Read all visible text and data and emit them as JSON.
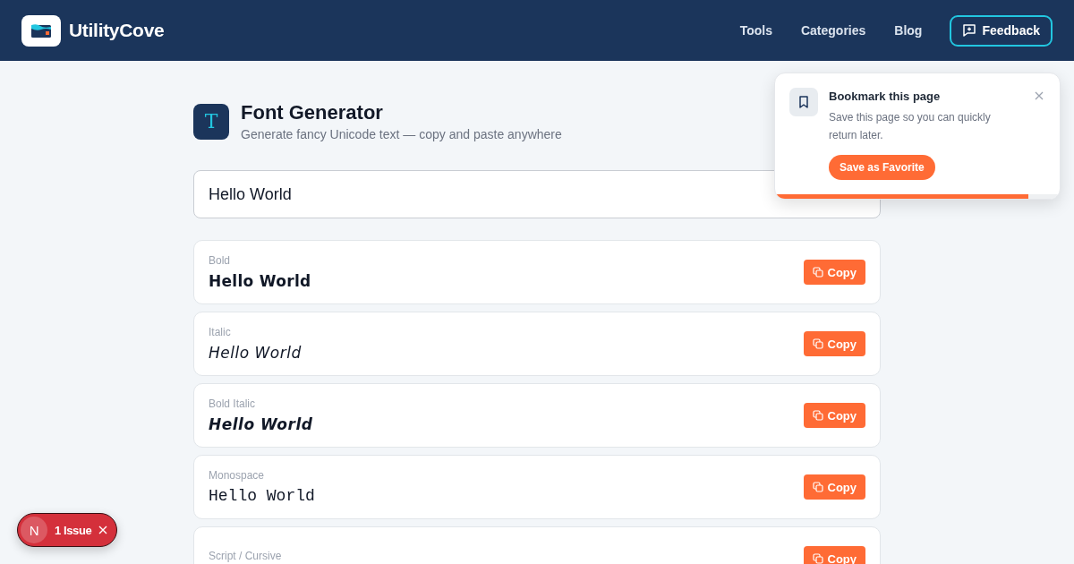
{
  "header": {
    "brand": "UtilityCove",
    "nav": [
      {
        "label": "Tools"
      },
      {
        "label": "Categories"
      },
      {
        "label": "Blog"
      }
    ],
    "feedback_button": "Feedback"
  },
  "tool": {
    "icon_letter": "T",
    "title": "Font Generator",
    "subtitle": "Generate fancy Unicode text — copy and paste anywhere"
  },
  "input": {
    "value": "Hello World"
  },
  "styles": [
    {
      "kind": "bold",
      "label": "Bold",
      "sample": "Hello World",
      "button": "Copy"
    },
    {
      "kind": "italic",
      "label": "Italic",
      "sample": "Hello World",
      "button": "Copy"
    },
    {
      "kind": "bold-italic",
      "label": "Bold Italic",
      "sample": "Hello World",
      "button": "Copy"
    },
    {
      "kind": "monospace",
      "label": "Monospace",
      "sample": "Hello World",
      "button": "Copy"
    },
    {
      "label": "Script / Cursive",
      "button": "Copy"
    }
  ],
  "toast": {
    "title": "Bookmark this page",
    "message": "Save this page so you can quickly return later.",
    "button": "Save as Favorite",
    "level": 0.89
  },
  "issue_badge": {
    "letter": "N",
    "label": "1 Issue"
  }
}
